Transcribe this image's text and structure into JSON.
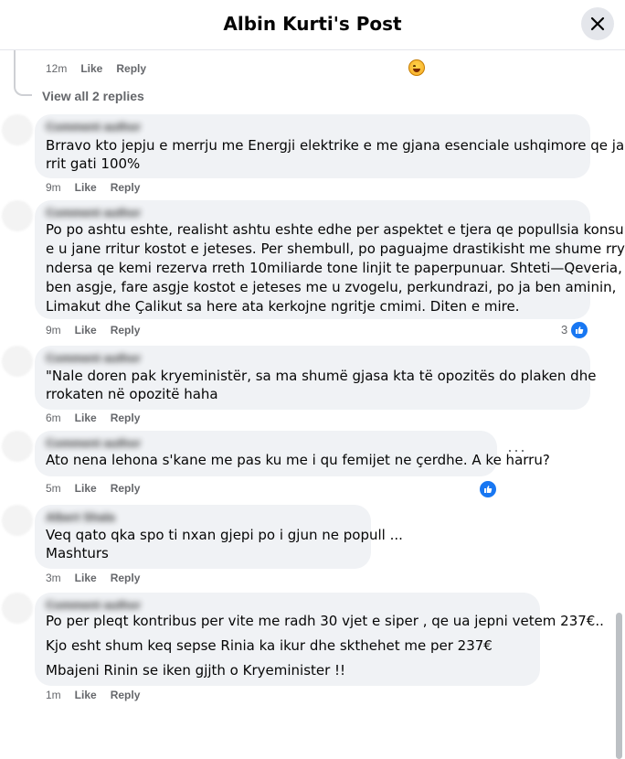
{
  "header": {
    "title": "Albin Kurti's Post"
  },
  "icons": {
    "close": "close-icon",
    "like": "like-icon",
    "laugh": "haha-emoji-icon",
    "more": "more-icon"
  },
  "colors": {
    "accent": "#1877f2",
    "bubble": "#f0f2f5",
    "meta": "#65676b"
  },
  "top_reply": {
    "time": "12m",
    "like": "Like",
    "reply": "Reply"
  },
  "view_replies": "View all 2 replies",
  "comments": [
    {
      "author": "Comment author",
      "lines": [
        "Brravo kto jepju e merrju me Energji elektrike e me gjana esenciale ushqimore qe jane",
        "rrit gati 100%"
      ],
      "time": "9m",
      "like": "Like",
      "reply": "Reply"
    },
    {
      "author": "Comment author",
      "lines": [
        "Po po ashtu eshte, realisht ashtu eshte edhe per aspektet e tjera qe popullsia konsumon",
        "e u jane rritur kostot e jeteses. Per shembull, po paguajme drastikisht me shume rryme,",
        "ndersa qe kemi rezerva rreth 10miliarde tone linjit te paperpunuar. Shteti—Qeveria, spo",
        "ben asgje, fare asgje kostot e jeteses me u zvogelu, perkundrazi, po ja ben aminin,",
        "Limakut dhe Çalikut sa here ata kerkojne ngritje cmimi. Diten e mire."
      ],
      "time": "9m",
      "like": "Like",
      "reply": "Reply",
      "reactions": "3"
    },
    {
      "author": "Comment author",
      "lines": [
        "\"Nale doren pak kryeministër, sa ma shumë gjasa kta të opozitës do plaken dhe",
        "rrokaten në opozitë haha"
      ],
      "time": "6m",
      "like": "Like",
      "reply": "Reply"
    },
    {
      "author": "Comment author",
      "lines": [
        "Ato nena lehona s'kane me pas ku me i qu femijet ne çerdhe. A ke harru?"
      ],
      "time": "5m",
      "like": "Like",
      "reply": "Reply",
      "more": "···"
    },
    {
      "author": "Albert Shala",
      "lines": [
        "Veq qato qka spo ti nxan gjepi po i gjun ne popull ...",
        "Mashturs"
      ],
      "time": "3m",
      "like": "Like",
      "reply": "Reply"
    },
    {
      "author": "Comment author",
      "lines": [
        "Po per pleqt kontribus per vite me radh 30 vjet e siper , qe ua jepni vetem 237€..",
        "Kjo esht shum keq sepse Rinia ka ikur dhe skthehet me per 237€",
        "Mbajeni Rinin se iken gjjth o Kryeminister !!"
      ],
      "time": "1m",
      "like": "Like",
      "reply": "Reply"
    }
  ]
}
